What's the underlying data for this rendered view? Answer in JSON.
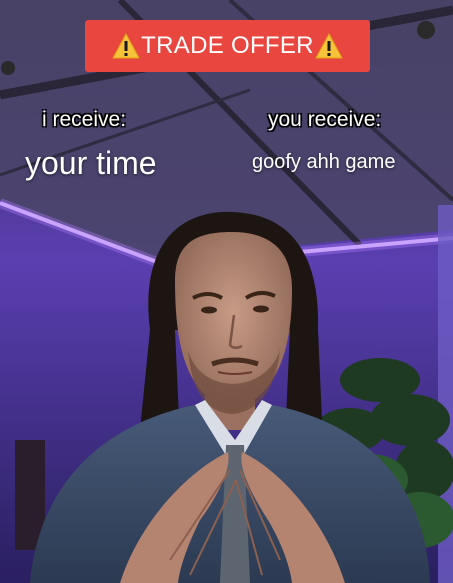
{
  "banner": {
    "text": "TRADE OFFER",
    "left_icon": "warning-icon",
    "right_icon": "warning-icon",
    "background_color": "#e8463e"
  },
  "offer": {
    "i_receive_label": "i receive:",
    "i_receive_value": "your time",
    "you_receive_label": "you receive:",
    "you_receive_value": "goofy ahh game"
  },
  "colors": {
    "led_light": "#c9a8ff",
    "room_purple": "#5a3fb0",
    "suit": "#3d4f6b"
  }
}
